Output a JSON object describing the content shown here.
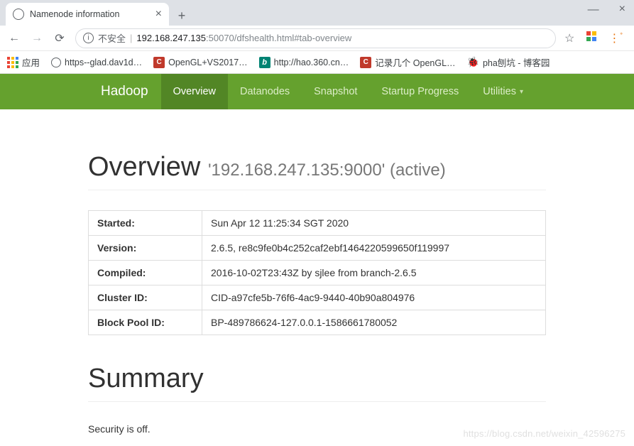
{
  "browser": {
    "tab_title": "Namenode information",
    "url_prefix_insecure": "不安全",
    "url_host": "192.168.247.135",
    "url_port_path": ":50070/dfshealth.html#tab-overview",
    "bookmarks_label": "应用",
    "bookmarks": [
      {
        "type": "globe",
        "label": "https--glad.dav1d…"
      },
      {
        "type": "red",
        "label": "OpenGL+VS2017…"
      },
      {
        "type": "bing",
        "label": "http://hao.360.cn…"
      },
      {
        "type": "red",
        "label": "记录几个 OpenGL…"
      },
      {
        "type": "bug",
        "label": "pha刨坑 - 博客园"
      }
    ]
  },
  "nav": {
    "brand": "Hadoop",
    "items": [
      {
        "label": "Overview",
        "active": true
      },
      {
        "label": "Datanodes",
        "active": false
      },
      {
        "label": "Snapshot",
        "active": false
      },
      {
        "label": "Startup Progress",
        "active": false
      },
      {
        "label": "Utilities",
        "active": false,
        "dropdown": true
      }
    ]
  },
  "overview": {
    "heading": "Overview",
    "host_port": "'192.168.247.135:9000' (active)",
    "rows": [
      {
        "k": "Started:",
        "v": "Sun Apr 12 11:25:34 SGT 2020"
      },
      {
        "k": "Version:",
        "v": "2.6.5, re8c9fe0b4c252caf2ebf1464220599650f119997"
      },
      {
        "k": "Compiled:",
        "v": "2016-10-02T23:43Z by sjlee from branch-2.6.5"
      },
      {
        "k": "Cluster ID:",
        "v": "CID-a97cfe5b-76f6-4ac9-9440-40b90a804976"
      },
      {
        "k": "Block Pool ID:",
        "v": "BP-489786624-127.0.0.1-1586661780052"
      }
    ]
  },
  "summary": {
    "heading": "Summary",
    "security_text": "Security is off."
  },
  "watermark": "https://blog.csdn.net/weixin_42596275"
}
